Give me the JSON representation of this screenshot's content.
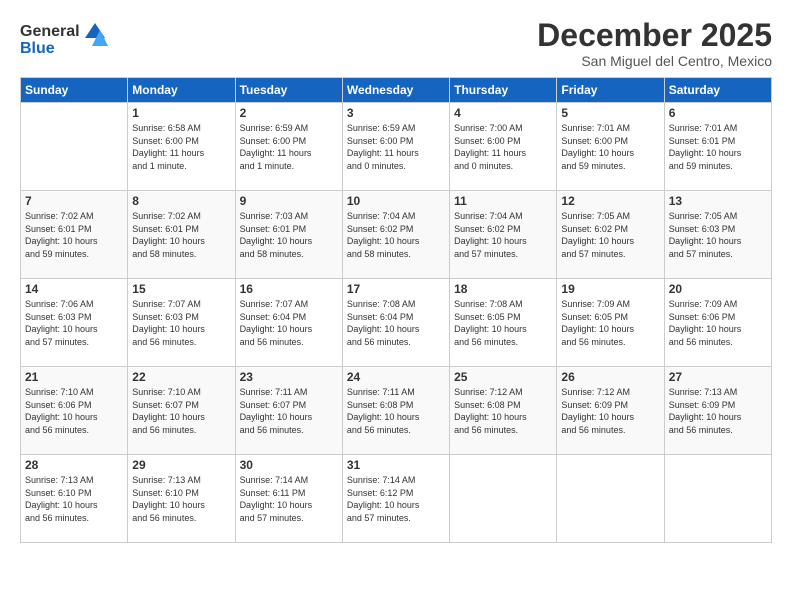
{
  "logo": {
    "line1": "General",
    "line2": "Blue"
  },
  "title": "December 2025",
  "subtitle": "San Miguel del Centro, Mexico",
  "header": {
    "days": [
      "Sunday",
      "Monday",
      "Tuesday",
      "Wednesday",
      "Thursday",
      "Friday",
      "Saturday"
    ]
  },
  "weeks": [
    [
      {
        "day": "",
        "info": ""
      },
      {
        "day": "1",
        "info": "Sunrise: 6:58 AM\nSunset: 6:00 PM\nDaylight: 11 hours\nand 1 minute."
      },
      {
        "day": "2",
        "info": "Sunrise: 6:59 AM\nSunset: 6:00 PM\nDaylight: 11 hours\nand 1 minute."
      },
      {
        "day": "3",
        "info": "Sunrise: 6:59 AM\nSunset: 6:00 PM\nDaylight: 11 hours\nand 0 minutes."
      },
      {
        "day": "4",
        "info": "Sunrise: 7:00 AM\nSunset: 6:00 PM\nDaylight: 11 hours\nand 0 minutes."
      },
      {
        "day": "5",
        "info": "Sunrise: 7:01 AM\nSunset: 6:00 PM\nDaylight: 10 hours\nand 59 minutes."
      },
      {
        "day": "6",
        "info": "Sunrise: 7:01 AM\nSunset: 6:01 PM\nDaylight: 10 hours\nand 59 minutes."
      }
    ],
    [
      {
        "day": "7",
        "info": "Sunrise: 7:02 AM\nSunset: 6:01 PM\nDaylight: 10 hours\nand 59 minutes."
      },
      {
        "day": "8",
        "info": "Sunrise: 7:02 AM\nSunset: 6:01 PM\nDaylight: 10 hours\nand 58 minutes."
      },
      {
        "day": "9",
        "info": "Sunrise: 7:03 AM\nSunset: 6:01 PM\nDaylight: 10 hours\nand 58 minutes."
      },
      {
        "day": "10",
        "info": "Sunrise: 7:04 AM\nSunset: 6:02 PM\nDaylight: 10 hours\nand 58 minutes."
      },
      {
        "day": "11",
        "info": "Sunrise: 7:04 AM\nSunset: 6:02 PM\nDaylight: 10 hours\nand 57 minutes."
      },
      {
        "day": "12",
        "info": "Sunrise: 7:05 AM\nSunset: 6:02 PM\nDaylight: 10 hours\nand 57 minutes."
      },
      {
        "day": "13",
        "info": "Sunrise: 7:05 AM\nSunset: 6:03 PM\nDaylight: 10 hours\nand 57 minutes."
      }
    ],
    [
      {
        "day": "14",
        "info": "Sunrise: 7:06 AM\nSunset: 6:03 PM\nDaylight: 10 hours\nand 57 minutes."
      },
      {
        "day": "15",
        "info": "Sunrise: 7:07 AM\nSunset: 6:03 PM\nDaylight: 10 hours\nand 56 minutes."
      },
      {
        "day": "16",
        "info": "Sunrise: 7:07 AM\nSunset: 6:04 PM\nDaylight: 10 hours\nand 56 minutes."
      },
      {
        "day": "17",
        "info": "Sunrise: 7:08 AM\nSunset: 6:04 PM\nDaylight: 10 hours\nand 56 minutes."
      },
      {
        "day": "18",
        "info": "Sunrise: 7:08 AM\nSunset: 6:05 PM\nDaylight: 10 hours\nand 56 minutes."
      },
      {
        "day": "19",
        "info": "Sunrise: 7:09 AM\nSunset: 6:05 PM\nDaylight: 10 hours\nand 56 minutes."
      },
      {
        "day": "20",
        "info": "Sunrise: 7:09 AM\nSunset: 6:06 PM\nDaylight: 10 hours\nand 56 minutes."
      }
    ],
    [
      {
        "day": "21",
        "info": "Sunrise: 7:10 AM\nSunset: 6:06 PM\nDaylight: 10 hours\nand 56 minutes."
      },
      {
        "day": "22",
        "info": "Sunrise: 7:10 AM\nSunset: 6:07 PM\nDaylight: 10 hours\nand 56 minutes."
      },
      {
        "day": "23",
        "info": "Sunrise: 7:11 AM\nSunset: 6:07 PM\nDaylight: 10 hours\nand 56 minutes."
      },
      {
        "day": "24",
        "info": "Sunrise: 7:11 AM\nSunset: 6:08 PM\nDaylight: 10 hours\nand 56 minutes."
      },
      {
        "day": "25",
        "info": "Sunrise: 7:12 AM\nSunset: 6:08 PM\nDaylight: 10 hours\nand 56 minutes."
      },
      {
        "day": "26",
        "info": "Sunrise: 7:12 AM\nSunset: 6:09 PM\nDaylight: 10 hours\nand 56 minutes."
      },
      {
        "day": "27",
        "info": "Sunrise: 7:13 AM\nSunset: 6:09 PM\nDaylight: 10 hours\nand 56 minutes."
      }
    ],
    [
      {
        "day": "28",
        "info": "Sunrise: 7:13 AM\nSunset: 6:10 PM\nDaylight: 10 hours\nand 56 minutes."
      },
      {
        "day": "29",
        "info": "Sunrise: 7:13 AM\nSunset: 6:10 PM\nDaylight: 10 hours\nand 56 minutes."
      },
      {
        "day": "30",
        "info": "Sunrise: 7:14 AM\nSunset: 6:11 PM\nDaylight: 10 hours\nand 57 minutes."
      },
      {
        "day": "31",
        "info": "Sunrise: 7:14 AM\nSunset: 6:12 PM\nDaylight: 10 hours\nand 57 minutes."
      },
      {
        "day": "",
        "info": ""
      },
      {
        "day": "",
        "info": ""
      },
      {
        "day": "",
        "info": ""
      }
    ]
  ]
}
